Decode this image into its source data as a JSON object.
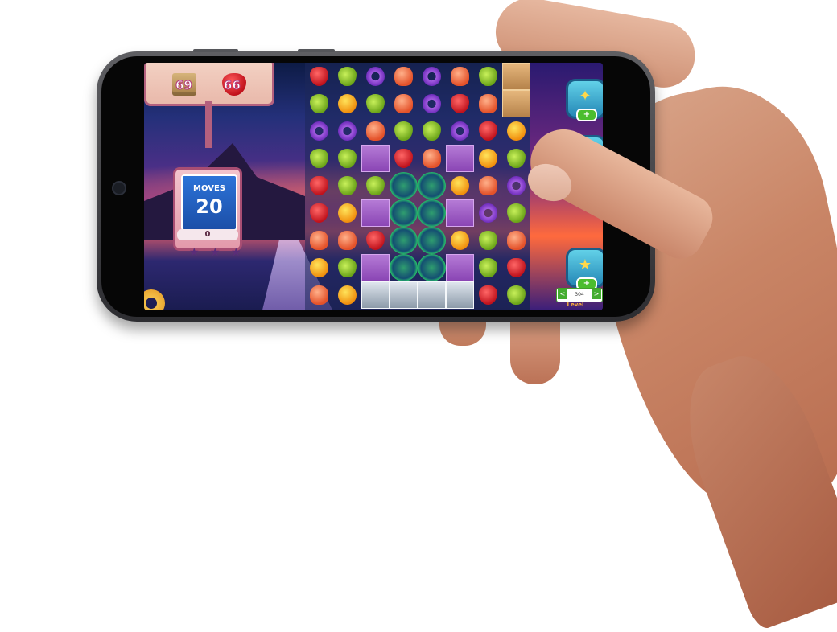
{
  "game": {
    "goals": [
      {
        "icon": "wood-crate-icon",
        "count": "69"
      },
      {
        "icon": "strawberry-icon",
        "count": "66"
      }
    ],
    "moves": {
      "label": "MOVES",
      "value": "20"
    },
    "score": "0",
    "stars": [
      "★",
      "★",
      "★"
    ],
    "boosters": [
      {
        "icon": "shuffle-booster-icon",
        "glyph": "✦",
        "plus": "+"
      },
      {
        "icon": "hand-booster-icon",
        "glyph": "✋",
        "plus": "+"
      },
      {
        "icon": "magic-wand-booster-icon",
        "glyph": "★",
        "plus": "+"
      }
    ],
    "level": {
      "number": "304",
      "label": "Level",
      "prev": "<",
      "next": ">"
    }
  },
  "board": {
    "cols": 8,
    "rows": 9,
    "cells": [
      [
        "strawberry",
        "pear",
        "donut",
        "jelly",
        "donut",
        "jelly",
        "pear",
        "box"
      ],
      [
        "pear",
        "orange",
        "pear",
        "jelly",
        "donut",
        "strawberry",
        "jelly",
        "box"
      ],
      [
        "donut",
        "donut",
        "jelly",
        "pear",
        "pear",
        "donut",
        "strawberry",
        "orange"
      ],
      [
        "pear",
        "pear",
        "lock",
        "strawberry",
        "jelly",
        "lock",
        "orange",
        "pear"
      ],
      [
        "strawberry",
        "pear",
        "pear",
        "portal",
        "portal",
        "orange",
        "jelly",
        "donut"
      ],
      [
        "strawberry",
        "orange",
        "lock",
        "portal",
        "portal",
        "lock",
        "donut",
        "pear"
      ],
      [
        "jelly",
        "jelly",
        "strawberry",
        "portal",
        "portal",
        "orange",
        "pear",
        "jelly"
      ],
      [
        "orange",
        "pear",
        "lock",
        "portal",
        "portal",
        "lock",
        "pear",
        "strawberry"
      ],
      [
        "jelly",
        "orange",
        "ice",
        "ice",
        "ice",
        "ice",
        "strawberry",
        "pear"
      ]
    ]
  }
}
